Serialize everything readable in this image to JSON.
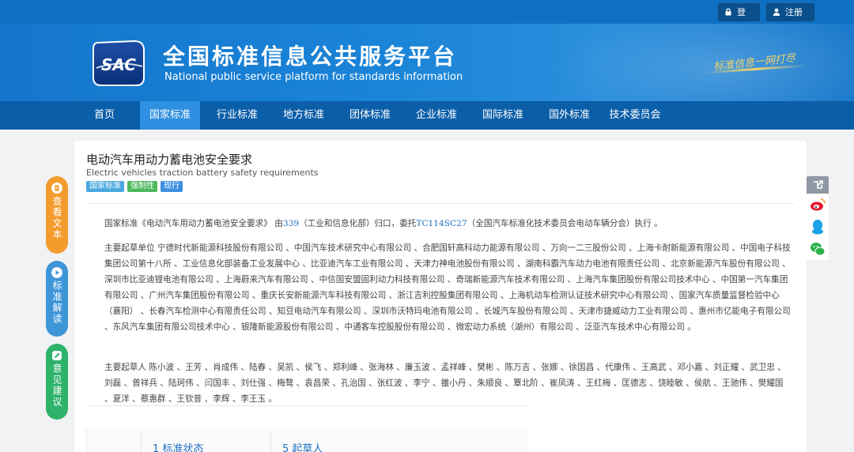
{
  "topbar": {
    "login_label": "登录",
    "register_label": "注册"
  },
  "banner": {
    "logo_text": "SAC",
    "title": "全国标准信息公共服务平台",
    "subtitle": "National public service platform  for standards information",
    "slogan": "标准信息一网打尽"
  },
  "nav": {
    "items": [
      {
        "label": "首页"
      },
      {
        "label": "国家标准"
      },
      {
        "label": "行业标准"
      },
      {
        "label": "地方标准"
      },
      {
        "label": "团体标准"
      },
      {
        "label": "企业标准"
      },
      {
        "label": "国际标准"
      },
      {
        "label": "国外标准"
      },
      {
        "label": "技术委员会"
      }
    ],
    "active_index": 1
  },
  "side": {
    "view_text": "查看文本",
    "interpret": "标准解读",
    "feedback": "意见建议"
  },
  "share": {
    "icons": [
      "share-icon",
      "weibo-icon",
      "qq-icon",
      "wechat-icon"
    ]
  },
  "document": {
    "title": "电动汽车用动力蓄电池安全要求",
    "subtitle": "Electric vehicles traction battery safety requirements",
    "tags": [
      {
        "label": "国家标准",
        "color": "#4aa8e0"
      },
      {
        "label": "强制性",
        "color": "#4cb85c"
      },
      {
        "label": "现行",
        "color": "#3d8fe0"
      }
    ],
    "para1": {
      "before": "国家标准《电动汽车用动力蓄电池安全要求》 由",
      "link1": "339",
      "middle": "（工业和信息化部）归口，委托",
      "link2": "TC114SC27",
      "after": "（全国汽车标准化技术委员会电动车辆分会）执行 。"
    },
    "para2": "主要起草单位 宁德时代新能源科技股份有限公司 、中国汽车技术研究中心有限公司 、合肥国轩高科动力能源有限公司 、万向一二三股份公司 、上海卡耐新能源有限公司 、中国电子科技集团公司第十八所 、工业信息化部装备工业发展中心 、比亚迪汽车工业有限公司 、天津力神电池股份有限公司 、湖南科霸汽车动力电池有限责任公司 、北京新能源汽车股份有限公司 、深圳市比亚迪锂电池有限公司 、上海蔚来汽车有限公司 、中信国安盟固利动力科技有限公司 、奇瑞新能源汽车技术有限公司 、上海汽车集团股份有限公司技术中心 、中国第一汽车集团有限公司 、广州汽车集团股份有限公司 、重庆长安新能源汽车科技有限公司 、浙江吉利控股集团有限公司 、上海机动车检测认证技术研究中心有限公司 、国家汽车质量监督检验中心（襄阳） 、长春汽车检测中心有限责任公司 、知豆电动汽车有限公司 、深圳市沃特玛电池有限公司 、长城汽车股份有限公司 、天津市捷威动力工业有限公司 、惠州市亿能电子有限公司 、东风汽车集团有限公司技术中心 、银隆新能源股份有限公司 、中通客车控股股份有限公司 、微宏动力系统（湖州）有限公司 、泛亚汽车技术中心有限公司 。",
    "para3": "主要起草人 陈小波 、王芳 、肖成伟 、陆春 、吴凯 、侯飞 、郑利峰 、张海林 、廉玉波 、孟祥峰 、樊彬 、陈万吉 、张娜 、徐国昌 、代康伟 、王高武 、邓小嘉 、刘正耀 、武卫忠 、刘磊 、曾祥兵 、陆珂伟 、闫国丰 、刘仕强 、梅骜 、袁昌荣 、孔治国 、张红波 、李宁 、雒小丹 、朱顺良 、覃北阶 、崔凤涛 、王红梅 、匡德志 、饶睦敏 、侯航 、王驰伟 、樊耀国 、夏洋 、蔡惠群 、王钦普 、李辉 、李王玉 。",
    "toc": [
      {
        "label": "1  标准状态"
      },
      {
        "label": "5  起草人"
      }
    ]
  }
}
